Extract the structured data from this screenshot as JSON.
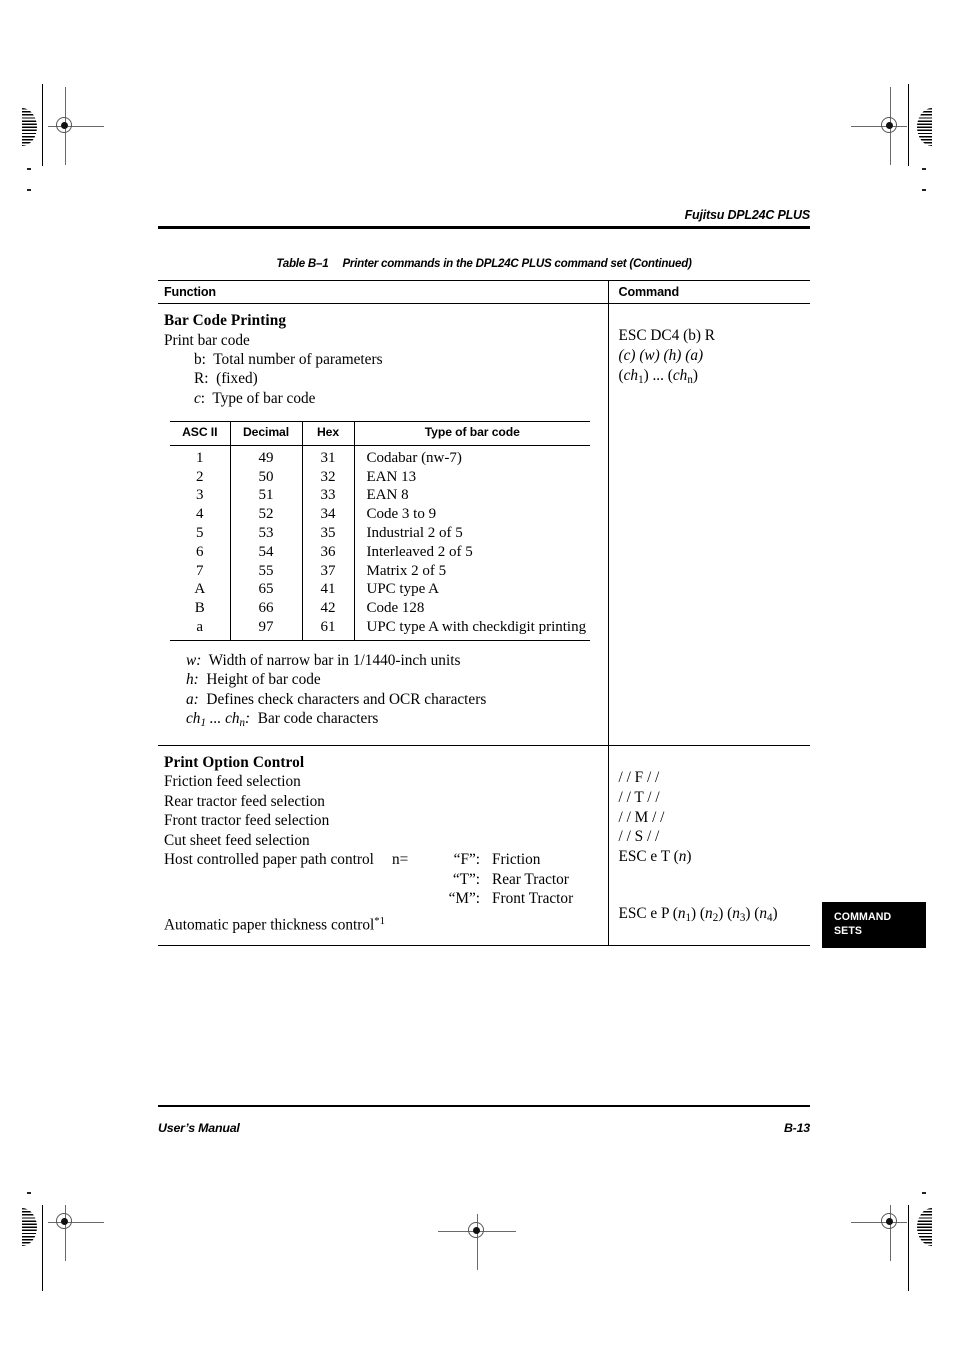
{
  "running_head": "Fujitsu DPL24C PLUS",
  "table_caption": {
    "number": "Table B–1",
    "text": "Printer commands in the DPL24C PLUS command set (Continued)"
  },
  "columns": {
    "function": "Function",
    "command": "Command"
  },
  "sections": [
    {
      "title": "Bar Code Printing",
      "subtitle": "Print bar code",
      "params_top": [
        "b:  Total number of parameters",
        "R:  (fixed)",
        "c:  Type of bar code"
      ],
      "command_lines": [
        "ESC DC4 (b) R",
        "(c) (w) (h) (a)",
        "(ch1) ... (chn)"
      ],
      "barcode_table": {
        "headers": [
          "ASC II",
          "Decimal",
          "Hex",
          "Type of bar code"
        ],
        "rows": [
          [
            "1",
            "49",
            "31",
            "Codabar (nw-7)"
          ],
          [
            "2",
            "50",
            "32",
            "EAN 13"
          ],
          [
            "3",
            "51",
            "33",
            "EAN 8"
          ],
          [
            "4",
            "52",
            "34",
            "Code 3 to 9"
          ],
          [
            "5",
            "53",
            "35",
            "Industrial 2 of 5"
          ],
          [
            "6",
            "54",
            "36",
            "Interleaved 2 of 5"
          ],
          [
            "7",
            "55",
            "37",
            "Matrix 2 of 5"
          ],
          [
            "A",
            "65",
            "41",
            "UPC type A"
          ],
          [
            "B",
            "66",
            "42",
            "Code 128"
          ],
          [
            "a",
            "97",
            "61",
            "UPC type A with checkdigit printing"
          ]
        ]
      },
      "params_bottom": [
        "w:  Width of narrow bar in 1/1440-inch units",
        "h:  Height of bar code",
        "a:  Defines check characters and OCR characters",
        "ch1 ... chn:  Bar code characters"
      ]
    },
    {
      "title": "Print Option Control",
      "rows": [
        {
          "function": "Friction feed selection",
          "command": "/ / F / /"
        },
        {
          "function": "Rear tractor feed selection",
          "command": "/ / T / /"
        },
        {
          "function": "Front tractor feed selection",
          "command": "/ / M / /"
        },
        {
          "function": "Cut sheet feed selection",
          "command": "/ / S / /"
        },
        {
          "function": "Host controlled paper path control",
          "command": "ESC e T (n)"
        }
      ],
      "path_param_label": "n=",
      "path_options": [
        {
          "code": "“F”:",
          "name": "Friction"
        },
        {
          "code": "“T”:",
          "name": "Rear Tractor"
        },
        {
          "code": "“M”:",
          "name": "Front Tractor"
        }
      ],
      "thickness_row": {
        "function": "Automatic paper thickness control",
        "footnote": "*1",
        "command": "ESC e P (n1) (n2) (n3) (n4)"
      }
    }
  ],
  "thumb_tab": {
    "line1": "COMMAND",
    "line2": "SETS"
  },
  "footer": {
    "left": "User’s Manual",
    "right": "B-13"
  },
  "colors": {
    "ink": "#000000",
    "paper": "#ffffff",
    "reg_mark": "#6a6a6a"
  }
}
